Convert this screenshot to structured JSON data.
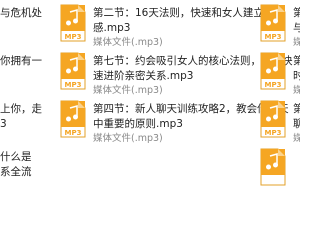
{
  "icon_badge": "MP3",
  "colors": {
    "icon_accent": "#f0a31a",
    "selected_bg": "#ffffff"
  },
  "left_column": [
    {
      "name": "与危机处"
    },
    {
      "name": "你拥有一"
    },
    {
      "name": "上你，走\n3"
    },
    {
      "name": "什么是\n系全流"
    }
  ],
  "main_column": [
    {
      "name": "第二节：16天法则，快速和女人建立联系感.mp3",
      "type": "媒体文件(.mp3)"
    },
    {
      "name": "第七节：约会吸引女人的核心法则，让你快速进阶亲密关系.mp3",
      "type": "媒体文件(.mp3)"
    },
    {
      "name": "第四节：新人聊天训练攻略2，教会你聊天中重要的原则.mp3",
      "type": "媒体文件(.mp3)"
    }
  ],
  "right_column": [
    {
      "name": "第\n与",
      "type": "媒"
    },
    {
      "name": "第\n时",
      "type": "媒"
    },
    {
      "name": "第\n聊",
      "type": "媒"
    },
    {
      "name": ""
    }
  ]
}
